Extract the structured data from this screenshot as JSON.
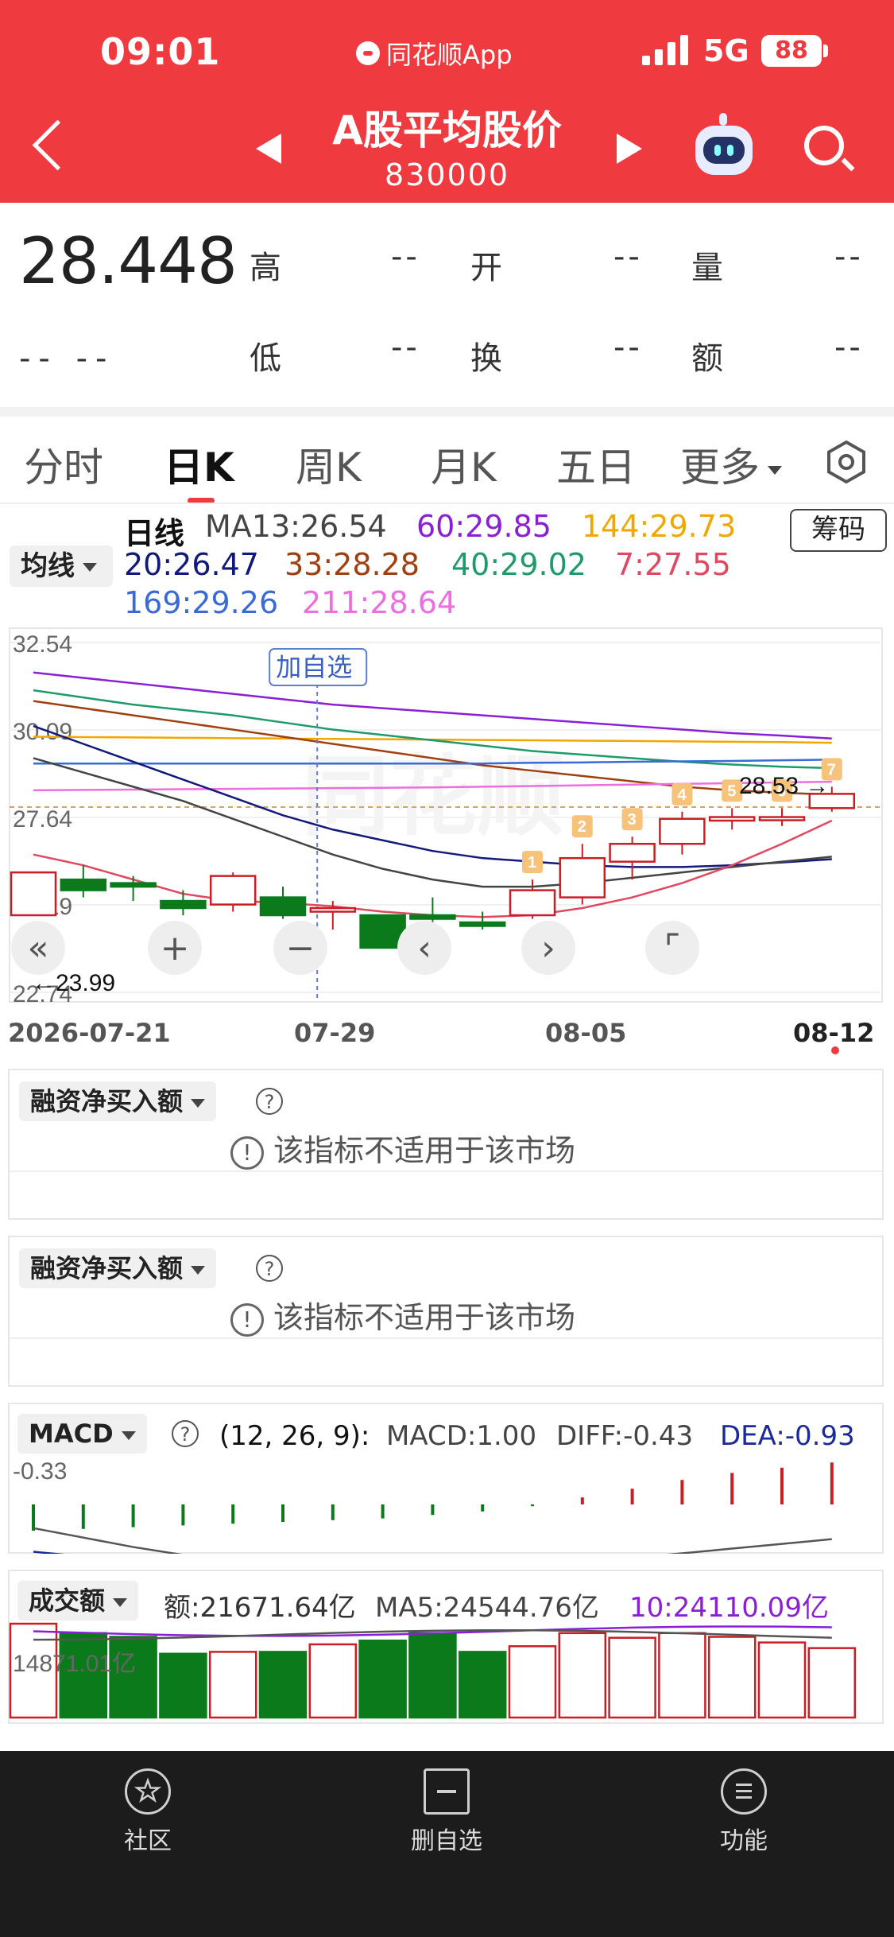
{
  "status_bar": {
    "time": "09:01",
    "app": "同花顺App",
    "network": "5G",
    "battery": "88"
  },
  "header": {
    "title": "A股平均股价",
    "code": "830000"
  },
  "quote": {
    "price": "28.448",
    "change": "-- --",
    "labels": {
      "high": "高",
      "open": "开",
      "volume": "量",
      "low": "低",
      "turnover": "换",
      "amount": "额"
    },
    "values": {
      "high": "--",
      "open": "--",
      "volume": "--",
      "low": "--",
      "turnover": "--",
      "amount": "--"
    }
  },
  "tabs": {
    "items": [
      "分时",
      "日K",
      "周K",
      "月K",
      "五日",
      "更多"
    ],
    "active": "日K"
  },
  "ma_selector": "均线",
  "chip_button": "筹码",
  "ma_legend": {
    "label": "日线",
    "ma13": "MA13:26.54",
    "ma60": "60:29.85",
    "ma144": "144:29.73",
    "ma20": "20:26.47",
    "ma33": "33:28.28",
    "ma40": "40:29.02",
    "ma7": "7:27.55",
    "ma169": "169:29.26",
    "ma211": "211:28.64"
  },
  "colors": {
    "brand_red": "#ef3a40",
    "ma13": "#444444",
    "ma60": "#8b1fd6",
    "ma144": "#f0a800",
    "ma20": "#111a7a",
    "ma33": "#a04010",
    "ma40": "#1f9a6a",
    "ma7": "#e04860",
    "ma169": "#3a6ad8",
    "ma211": "#ec6ee0",
    "up": "#c81e24",
    "down": "#0a7a1a"
  },
  "chart_data": {
    "type": "candlestick",
    "y_ticks": [
      "32.54",
      "30.09",
      "27.64",
      "25.19",
      "22.74"
    ],
    "ylim": [
      22.74,
      32.54
    ],
    "x_labels": [
      "2026-07-21",
      "07-29",
      "08-05",
      "08-12"
    ],
    "candles": [
      {
        "o": 24.9,
        "c": 26.1,
        "h": 26.1,
        "l": 24.9
      },
      {
        "o": 25.9,
        "c": 25.6,
        "h": 26.3,
        "l": 25.4
      },
      {
        "o": 25.8,
        "c": 25.7,
        "h": 26.0,
        "l": 25.3
      },
      {
        "o": 25.3,
        "c": 25.1,
        "h": 25.6,
        "l": 24.9
      },
      {
        "o": 25.2,
        "c": 26.0,
        "h": 26.1,
        "l": 25.0
      },
      {
        "o": 25.4,
        "c": 24.9,
        "h": 25.7,
        "l": 24.8
      },
      {
        "o": 25.0,
        "c": 25.1,
        "h": 25.3,
        "l": 24.5
      },
      {
        "o": 24.9,
        "c": 23.99,
        "h": 24.9,
        "l": 23.99
      },
      {
        "o": 24.9,
        "c": 24.8,
        "h": 25.4,
        "l": 24.6
      },
      {
        "o": 24.7,
        "c": 24.6,
        "h": 25.0,
        "l": 24.5
      },
      {
        "o": 24.9,
        "c": 25.6,
        "h": 25.9,
        "l": 24.8
      },
      {
        "o": 25.4,
        "c": 26.5,
        "h": 26.9,
        "l": 25.2
      },
      {
        "o": 26.4,
        "c": 26.9,
        "h": 27.1,
        "l": 25.9
      },
      {
        "o": 26.9,
        "c": 27.6,
        "h": 27.8,
        "l": 26.6
      },
      {
        "o": 27.55,
        "c": 27.65,
        "h": 27.9,
        "l": 27.3
      },
      {
        "o": 27.6,
        "c": 27.65,
        "h": 27.9,
        "l": 27.4
      },
      {
        "o": 27.9,
        "c": 28.3,
        "h": 28.5,
        "l": 27.8
      }
    ],
    "ma_lines": [
      {
        "name": "60",
        "color": "#8b1fd6",
        "values": [
          31.7,
          31.55,
          31.4,
          31.25,
          31.1,
          30.95,
          30.8,
          30.7,
          30.6,
          30.5,
          30.4,
          30.3,
          30.2,
          30.1,
          30.0,
          29.93,
          29.85
        ]
      },
      {
        "name": "144",
        "color": "#f0a800",
        "values": [
          29.9,
          29.89,
          29.88,
          29.87,
          29.86,
          29.85,
          29.84,
          29.83,
          29.82,
          29.81,
          29.8,
          29.79,
          29.78,
          29.77,
          29.76,
          29.75,
          29.73
        ]
      },
      {
        "name": "40",
        "color": "#1f9a6a",
        "values": [
          31.2,
          31.0,
          30.8,
          30.65,
          30.5,
          30.3,
          30.1,
          29.95,
          29.8,
          29.65,
          29.5,
          29.4,
          29.3,
          29.2,
          29.12,
          29.06,
          29.02
        ]
      },
      {
        "name": "33",
        "color": "#a04010",
        "values": [
          30.9,
          30.7,
          30.5,
          30.3,
          30.1,
          29.9,
          29.7,
          29.5,
          29.3,
          29.1,
          28.95,
          28.8,
          28.65,
          28.5,
          28.4,
          28.33,
          28.28
        ]
      },
      {
        "name": "169",
        "color": "#3a6ad8",
        "values": [
          29.15,
          29.15,
          29.15,
          29.15,
          29.15,
          29.15,
          29.15,
          29.15,
          29.15,
          29.15,
          29.17,
          29.18,
          29.2,
          29.21,
          29.22,
          29.24,
          29.26
        ]
      },
      {
        "name": "211",
        "color": "#ec6ee0",
        "values": [
          28.4,
          28.41,
          28.42,
          28.43,
          28.44,
          28.45,
          28.46,
          28.47,
          28.48,
          28.5,
          28.52,
          28.54,
          28.56,
          28.58,
          28.6,
          28.62,
          28.64
        ]
      },
      {
        "name": "20",
        "color": "#111a7a",
        "values": [
          30.2,
          29.7,
          29.2,
          28.7,
          28.2,
          27.7,
          27.3,
          27.0,
          26.7,
          26.5,
          26.4,
          26.3,
          26.25,
          26.25,
          26.3,
          26.38,
          26.47
        ]
      },
      {
        "name": "13",
        "color": "#444444",
        "values": [
          29.3,
          28.9,
          28.5,
          28.1,
          27.6,
          27.1,
          26.6,
          26.2,
          25.9,
          25.7,
          25.7,
          25.8,
          25.95,
          26.1,
          26.25,
          26.4,
          26.54
        ]
      },
      {
        "name": "7",
        "color": "#e04860",
        "values": [
          26.6,
          26.3,
          25.9,
          25.5,
          25.3,
          25.25,
          25.15,
          25.0,
          24.9,
          24.85,
          24.9,
          25.1,
          25.4,
          25.8,
          26.3,
          26.9,
          27.55
        ]
      }
    ],
    "dashed_price": 27.93,
    "markers": [
      "1",
      "2",
      "3",
      "4",
      "5",
      "6",
      "7"
    ],
    "high_label": "28.53",
    "low_label": "23.99",
    "add_watchlist": "加自选"
  },
  "indicator_panels": [
    {
      "name": "融资净买入额",
      "notice": "该指标不适用于该市场"
    },
    {
      "name": "融资净买入额",
      "notice": "该指标不适用于该市场"
    }
  ],
  "macd": {
    "name": "MACD",
    "params": "(12, 26, 9):",
    "macd": "MACD:1.00",
    "diff": "DIFF:-0.43",
    "dea": "DEA:-0.93",
    "axis_label": "-0.33",
    "bars": [
      -0.3,
      -0.28,
      -0.26,
      -0.24,
      -0.22,
      -0.2,
      -0.18,
      -0.16,
      -0.12,
      -0.08,
      -0.02,
      0.08,
      0.18,
      0.28,
      0.36,
      0.42,
      0.48
    ],
    "diff_line": [
      -0.2,
      -0.32,
      -0.44,
      -0.54,
      -0.62,
      -0.7,
      -0.76,
      -0.8,
      -0.82,
      -0.8,
      -0.74,
      -0.66,
      -0.58,
      -0.52,
      -0.46,
      -0.4,
      -0.34
    ],
    "dea_line": [
      -0.5,
      -0.56,
      -0.62,
      -0.68,
      -0.74,
      -0.8,
      -0.84,
      -0.86,
      -0.86,
      -0.85,
      -0.82,
      -0.78,
      -0.74,
      -0.7,
      -0.66,
      -0.62,
      -0.58
    ]
  },
  "volume": {
    "name": "成交额",
    "amount": "额:21671.64亿",
    "ma5": "MA5:24544.76亿",
    "ma10": "10:24110.09亿",
    "axis_label": "14871.01亿",
    "bars": [
      {
        "v": 1.0,
        "up": true
      },
      {
        "v": 0.9,
        "up": false
      },
      {
        "v": 0.86,
        "up": false
      },
      {
        "v": 0.68,
        "up": false
      },
      {
        "v": 0.7,
        "up": true
      },
      {
        "v": 0.7,
        "up": false
      },
      {
        "v": 0.78,
        "up": true
      },
      {
        "v": 0.82,
        "up": false
      },
      {
        "v": 0.9,
        "up": false
      },
      {
        "v": 0.7,
        "up": false
      },
      {
        "v": 0.76,
        "up": true
      },
      {
        "v": 0.9,
        "up": true
      },
      {
        "v": 0.85,
        "up": true
      },
      {
        "v": 0.9,
        "up": true
      },
      {
        "v": 0.86,
        "up": true
      },
      {
        "v": 0.8,
        "up": true
      },
      {
        "v": 0.74,
        "up": true
      }
    ]
  },
  "bottom_nav": [
    {
      "label": "社区",
      "icon": "community-icon"
    },
    {
      "label": "删自选",
      "icon": "remove-watchlist-icon"
    },
    {
      "label": "功能",
      "icon": "menu-icon"
    }
  ]
}
